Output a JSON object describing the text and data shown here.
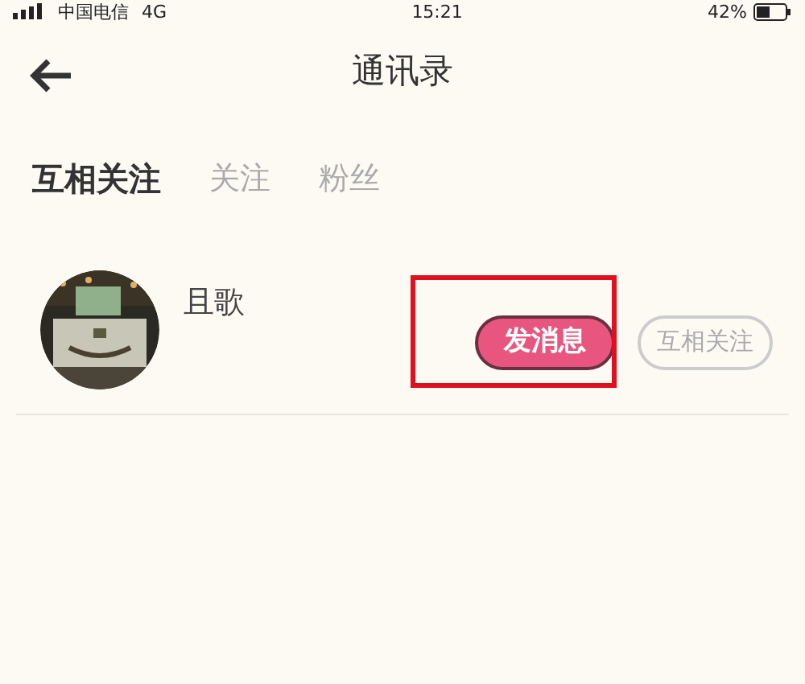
{
  "status_bar": {
    "carrier": "中国电信",
    "network": "4G",
    "time": "15:21",
    "battery": "42%"
  },
  "header": {
    "title": "通讯录"
  },
  "tabs": [
    {
      "label": "互相关注",
      "selected": true
    },
    {
      "label": "关注",
      "selected": false
    },
    {
      "label": "粉丝",
      "selected": false
    }
  ],
  "contacts": [
    {
      "name": "且歌",
      "message_button": "发消息",
      "follow_button": "互相关注",
      "highlighted": true
    }
  ]
}
